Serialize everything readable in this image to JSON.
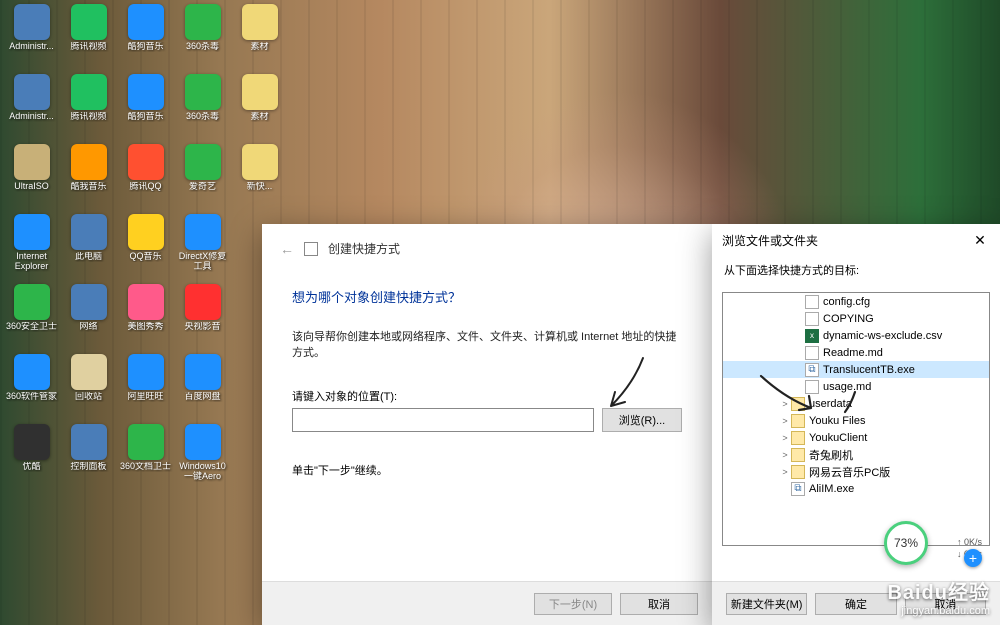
{
  "desktop": {
    "icons": [
      {
        "label": "Administr...",
        "color": "#4a7db8"
      },
      {
        "label": "腾讯视频",
        "color": "#20c060"
      },
      {
        "label": "酷狗音乐",
        "color": "#1e90ff"
      },
      {
        "label": "360杀毒",
        "color": "#2db54a"
      },
      {
        "label": "素材",
        "color": "#f0d878"
      },
      {
        "label": "Administr...",
        "color": "#4a7db8"
      },
      {
        "label": "腾讯视频",
        "color": "#20c060"
      },
      {
        "label": "酷狗音乐",
        "color": "#1e90ff"
      },
      {
        "label": "360杀毒",
        "color": "#2db54a"
      },
      {
        "label": "素材",
        "color": "#f0d878"
      },
      {
        "label": "UltraISO",
        "color": "#c8b078"
      },
      {
        "label": "酷我音乐",
        "color": "#ff9800"
      },
      {
        "label": "腾讯QQ",
        "color": "#ff5030"
      },
      {
        "label": "爱奇艺",
        "color": "#2db54a"
      },
      {
        "label": "新快...",
        "color": "#f0d878"
      },
      {
        "label": "Internet Explorer",
        "color": "#1e90ff"
      },
      {
        "label": "此电脑",
        "color": "#4a7db8"
      },
      {
        "label": "QQ音乐",
        "color": "#ffd020"
      },
      {
        "label": "DirectX修复工具",
        "color": "#1e90ff"
      },
      {
        "label": "",
        "color": "transparent"
      },
      {
        "label": "360安全卫士",
        "color": "#2db54a"
      },
      {
        "label": "网络",
        "color": "#4a7db8"
      },
      {
        "label": "美图秀秀",
        "color": "#ff5a8a"
      },
      {
        "label": "央视影音",
        "color": "#ff3030"
      },
      {
        "label": "",
        "color": "transparent"
      },
      {
        "label": "360软件管家",
        "color": "#1e90ff"
      },
      {
        "label": "回收站",
        "color": "#e0d0a0"
      },
      {
        "label": "阿里旺旺",
        "color": "#1e90ff"
      },
      {
        "label": "百度网盘",
        "color": "#1e90ff"
      },
      {
        "label": "",
        "color": "transparent"
      },
      {
        "label": "优酷",
        "color": "#303030"
      },
      {
        "label": "控制面板",
        "color": "#4a7db8"
      },
      {
        "label": "360文档卫士",
        "color": "#2db54a"
      },
      {
        "label": "Windows10一键Aero",
        "color": "#1e90ff"
      },
      {
        "label": "",
        "color": "transparent"
      }
    ]
  },
  "wizard": {
    "title": "创建快捷方式",
    "question": "想为哪个对象创建快捷方式？",
    "description": "该向导帮你创建本地或网络程序、文件、文件夹、计算机或 Internet 地址的快捷方式。",
    "location_label": "请键入对象的位置(T):",
    "location_value": "",
    "browse_btn": "浏览(R)...",
    "next_instruction": "单击\"下一步\"继续。",
    "next_btn": "下一步(N)",
    "cancel_btn": "取消"
  },
  "browse": {
    "title": "浏览文件或文件夹",
    "instruction": "从下面选择快捷方式的目标:",
    "tree": [
      {
        "depth": 5,
        "arrow": "",
        "icon": "file",
        "label": "config.cfg"
      },
      {
        "depth": 5,
        "arrow": "",
        "icon": "file",
        "label": "COPYING"
      },
      {
        "depth": 5,
        "arrow": "",
        "icon": "excel",
        "label": "dynamic-ws-exclude.csv"
      },
      {
        "depth": 5,
        "arrow": "",
        "icon": "file",
        "label": "Readme.md"
      },
      {
        "depth": 5,
        "arrow": "",
        "icon": "exe",
        "label": "TranslucentTB.exe",
        "sel": true
      },
      {
        "depth": 5,
        "arrow": "",
        "icon": "file",
        "label": "usage.md"
      },
      {
        "depth": 4,
        "arrow": ">",
        "icon": "folder",
        "label": "userdata"
      },
      {
        "depth": 4,
        "arrow": ">",
        "icon": "folder",
        "label": "Youku Files"
      },
      {
        "depth": 4,
        "arrow": ">",
        "icon": "folder",
        "label": "YoukuClient"
      },
      {
        "depth": 4,
        "arrow": ">",
        "icon": "folder",
        "label": "奇兔刷机"
      },
      {
        "depth": 4,
        "arrow": ">",
        "icon": "folder",
        "label": "网易云音乐PC版"
      },
      {
        "depth": 4,
        "arrow": "",
        "icon": "exe",
        "label": "AliIM.exe"
      }
    ],
    "new_folder_btn": "新建文件夹(M)",
    "ok_btn": "确定",
    "cancel_btn": "取消"
  },
  "speed": {
    "percent": "73%",
    "up": "0K/s",
    "down": "0K/s"
  },
  "watermark": {
    "brand": "Baidu经验",
    "url": "jingyan.baidu.com"
  }
}
